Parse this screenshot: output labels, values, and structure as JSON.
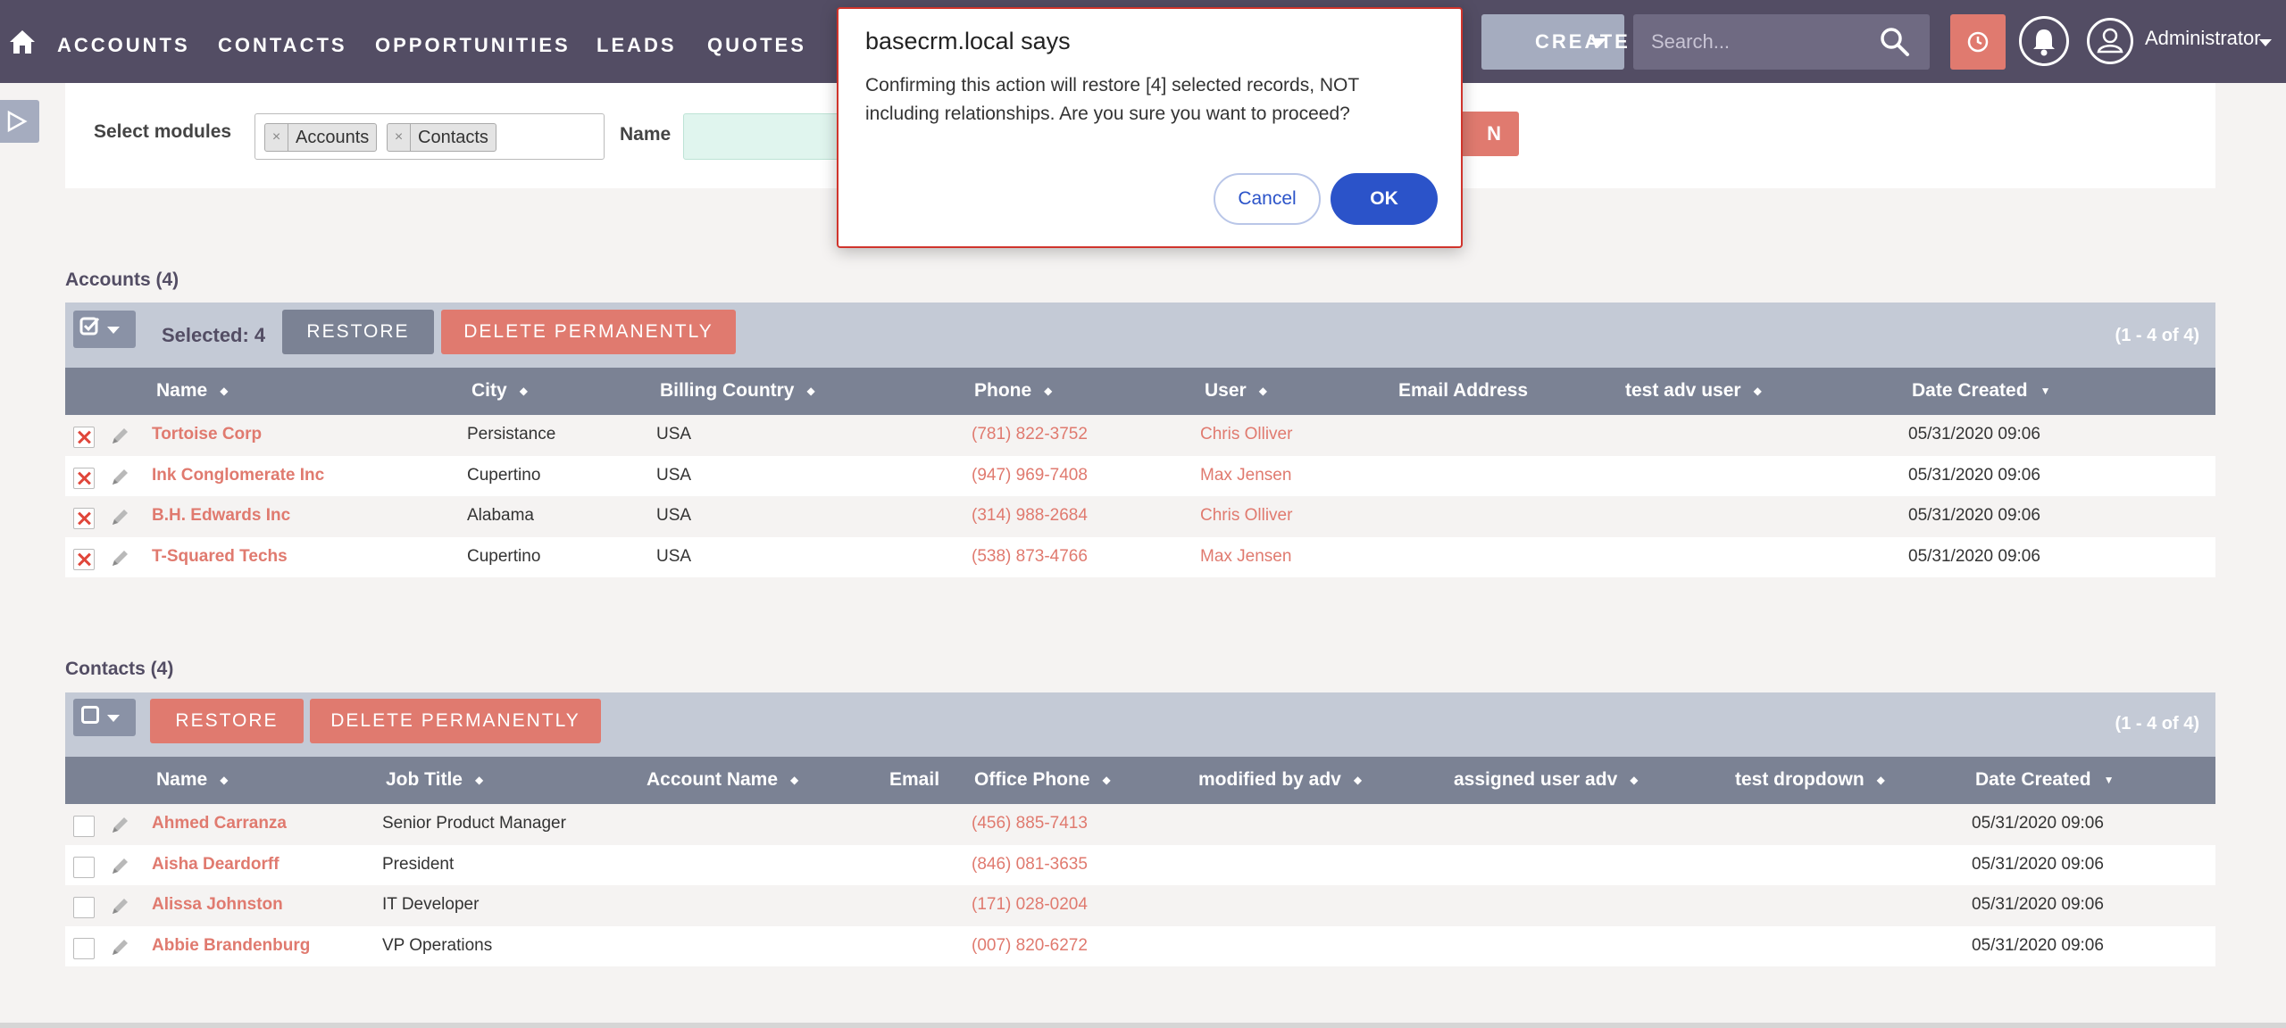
{
  "nav": {
    "items": [
      "ACCOUNTS",
      "CONTACTS",
      "OPPORTUNITIES",
      "LEADS",
      "QUOTES"
    ],
    "create_label": "CREATE",
    "search_placeholder": "Search...",
    "user_name": "Administrator"
  },
  "filter": {
    "select_modules_label": "Select modules",
    "chips": [
      "Accounts",
      "Contacts"
    ],
    "chip_remove": "×",
    "name_label": "Name",
    "hidden_button_fragment": "N"
  },
  "accounts": {
    "title": "Accounts (4)",
    "selected_text": "Selected: 4",
    "restore_label": "RESTORE",
    "delete_label": "DELETE PERMANENTLY",
    "pagination": "(1 - 4 of 4)",
    "columns": [
      "Name",
      "City",
      "Billing Country",
      "Phone",
      "User",
      "Email Address",
      "test adv user",
      "Date Created"
    ],
    "rows": [
      {
        "name": "Tortoise Corp",
        "city": "Persistance",
        "country": "USA",
        "phone": "(781) 822-3752",
        "user": "Chris Olliver",
        "date": "05/31/2020 09:06"
      },
      {
        "name": "Ink Conglomerate Inc",
        "city": "Cupertino",
        "country": "USA",
        "phone": "(947) 969-7408",
        "user": "Max Jensen",
        "date": "05/31/2020 09:06"
      },
      {
        "name": "B.H. Edwards Inc",
        "city": "Alabama",
        "country": "USA",
        "phone": "(314) 988-2684",
        "user": "Chris Olliver",
        "date": "05/31/2020 09:06"
      },
      {
        "name": "T-Squared Techs",
        "city": "Cupertino",
        "country": "USA",
        "phone": "(538) 873-4766",
        "user": "Max Jensen",
        "date": "05/31/2020 09:06"
      }
    ]
  },
  "contacts": {
    "title": "Contacts (4)",
    "restore_label": "RESTORE",
    "delete_label": "DELETE PERMANENTLY",
    "pagination": "(1 - 4 of 4)",
    "columns": [
      "Name",
      "Job Title",
      "Account Name",
      "Email",
      "Office Phone",
      "modified by adv",
      "assigned user adv",
      "test dropdown",
      "Date Created"
    ],
    "rows": [
      {
        "name": "Ahmed Carranza",
        "title": "Senior Product Manager",
        "phone": "(456) 885-7413",
        "date": "05/31/2020 09:06"
      },
      {
        "name": "Aisha Deardorff",
        "title": "President",
        "phone": "(846) 081-3635",
        "date": "05/31/2020 09:06"
      },
      {
        "name": "Alissa Johnston",
        "title": "IT Developer",
        "phone": "(171) 028-0204",
        "date": "05/31/2020 09:06"
      },
      {
        "name": "Abbie Brandenburg",
        "title": "VP Operations",
        "phone": "(007) 820-6272",
        "date": "05/31/2020 09:06"
      }
    ]
  },
  "dialog": {
    "title": "basecrm.local says",
    "message": "Confirming this action will restore [4] selected records, NOT including relationships. Are you sure you want to proceed?",
    "cancel_label": "Cancel",
    "ok_label": "OK"
  },
  "colors": {
    "nav_bg": "#534d64",
    "accent_red": "#e07a6f",
    "header_gray": "#7b8294",
    "dialog_blue": "#2b53c9"
  }
}
